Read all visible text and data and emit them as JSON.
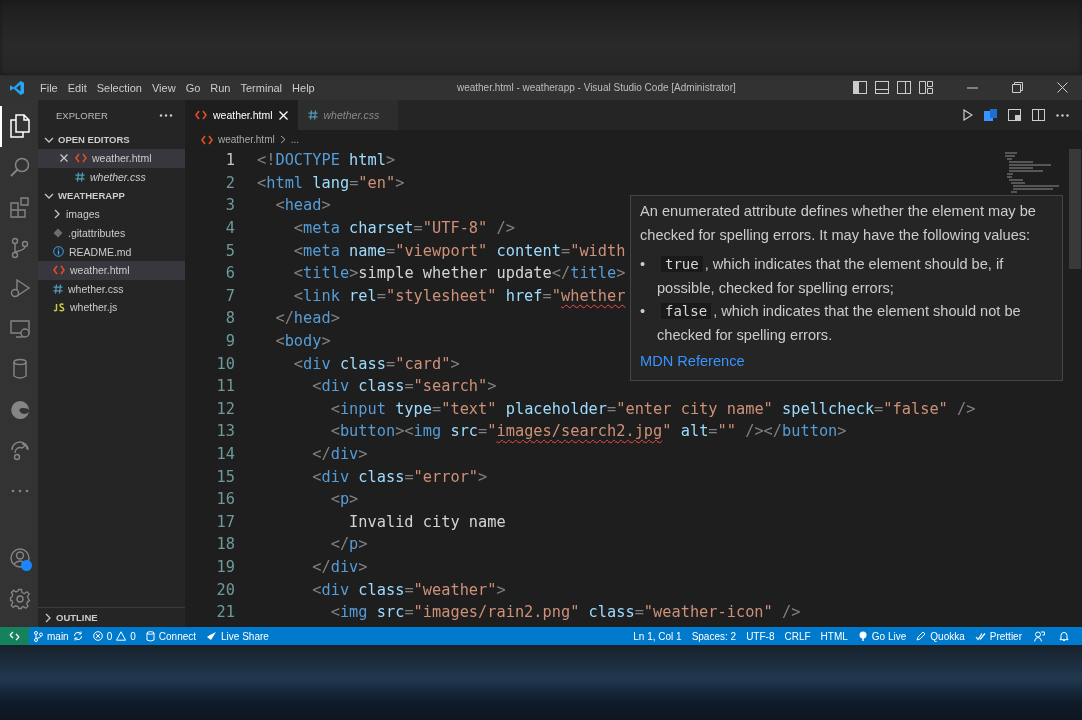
{
  "title_bar": {
    "menus": [
      "File",
      "Edit",
      "Selection",
      "View",
      "Go",
      "Run",
      "Terminal",
      "Help"
    ],
    "title": "weather.html - weatherapp - Visual Studio Code [Administrator]"
  },
  "activity_bar": {
    "items": [
      {
        "kind": "files",
        "selected": true
      },
      {
        "kind": "search",
        "selected": false
      },
      {
        "kind": "extensions",
        "selected": false
      },
      {
        "kind": "source-control",
        "selected": false
      },
      {
        "kind": "run-debug",
        "selected": false
      },
      {
        "kind": "remote",
        "selected": false
      },
      {
        "kind": "database",
        "selected": false
      },
      {
        "kind": "edge",
        "selected": false
      },
      {
        "kind": "live-share",
        "selected": false
      },
      {
        "kind": "more",
        "selected": false
      }
    ],
    "bottom": [
      {
        "kind": "account",
        "badge": true
      },
      {
        "kind": "settings",
        "badge": false
      }
    ]
  },
  "sidebar": {
    "title": "EXPLORER",
    "open_editors": {
      "label": "OPEN EDITORS",
      "expanded": true,
      "items": [
        {
          "name": "weather.html",
          "kind": "html",
          "selected": true,
          "preview": false
        },
        {
          "name": "whether.css",
          "kind": "css",
          "selected": false,
          "preview": true
        }
      ]
    },
    "folder": {
      "label": "WEATHERAPP",
      "expanded": true,
      "children": [
        {
          "name": "images",
          "kind": "folder",
          "selected": false
        },
        {
          "name": ".gitattributes",
          "kind": "git",
          "selected": false
        },
        {
          "name": "README.md",
          "kind": "md",
          "selected": false
        },
        {
          "name": "weather.html",
          "kind": "html",
          "selected": true
        },
        {
          "name": "whether.css",
          "kind": "css",
          "selected": false
        },
        {
          "name": "whether.js",
          "kind": "js",
          "selected": false
        }
      ]
    },
    "outline": {
      "label": "OUTLINE",
      "expanded": false
    }
  },
  "tabs": [
    {
      "name": "weather.html",
      "kind": "html",
      "selected": true,
      "preview": false
    },
    {
      "name": "whether.css",
      "kind": "css",
      "selected": false,
      "preview": true
    }
  ],
  "breadcrumb": {
    "file": "weather.html",
    "kind": "html",
    "rest": "..."
  },
  "editor": {
    "lines": [
      {
        "number": "1",
        "current": true,
        "tokens": [
          {
            "kind": "p",
            "text": "<!"
          },
          {
            "kind": "tag",
            "text": "DOCTYPE"
          },
          {
            "kind": "attr",
            "text": " html"
          },
          {
            "kind": "p",
            "text": ">"
          }
        ]
      },
      {
        "number": "2",
        "current": false,
        "tokens": [
          {
            "kind": "p",
            "text": "<"
          },
          {
            "kind": "tag",
            "text": "html"
          },
          {
            "kind": "attr",
            "text": " lang"
          },
          {
            "kind": "p",
            "text": "="
          },
          {
            "kind": "str",
            "text": "\"en\""
          },
          {
            "kind": "p",
            "text": ">"
          }
        ]
      },
      {
        "number": "3",
        "current": false,
        "tokens": [
          {
            "kind": "p",
            "text": "  <"
          },
          {
            "kind": "tag",
            "text": "head"
          },
          {
            "kind": "p",
            "text": ">"
          }
        ]
      },
      {
        "number": "4",
        "current": false,
        "tokens": [
          {
            "kind": "p",
            "text": "    <"
          },
          {
            "kind": "tag",
            "text": "meta"
          },
          {
            "kind": "attr",
            "text": " charset"
          },
          {
            "kind": "p",
            "text": "="
          },
          {
            "kind": "str",
            "text": "\"UTF-8\""
          },
          {
            "kind": "p",
            "text": " />"
          }
        ]
      },
      {
        "number": "5",
        "current": false,
        "tokens": [
          {
            "kind": "p",
            "text": "    <"
          },
          {
            "kind": "tag",
            "text": "meta"
          },
          {
            "kind": "attr",
            "text": " name"
          },
          {
            "kind": "p",
            "text": "="
          },
          {
            "kind": "str",
            "text": "\"viewport\""
          },
          {
            "kind": "attr",
            "text": " content"
          },
          {
            "kind": "p",
            "text": "="
          },
          {
            "kind": "str",
            "text": "\"width"
          }
        ]
      },
      {
        "number": "6",
        "current": false,
        "tokens": [
          {
            "kind": "p",
            "text": "    <"
          },
          {
            "kind": "tag",
            "text": "title"
          },
          {
            "kind": "p",
            "text": ">"
          },
          {
            "kind": "text",
            "text": "simple whether update"
          },
          {
            "kind": "p",
            "text": "</"
          },
          {
            "kind": "tag",
            "text": "title"
          },
          {
            "kind": "p",
            "text": ">"
          }
        ]
      },
      {
        "number": "7",
        "current": false,
        "tokens": [
          {
            "kind": "p",
            "text": "    <"
          },
          {
            "kind": "tag",
            "text": "link"
          },
          {
            "kind": "attr",
            "text": " rel"
          },
          {
            "kind": "p",
            "text": "="
          },
          {
            "kind": "str",
            "text": "\"stylesheet\""
          },
          {
            "kind": "attr",
            "text": " href"
          },
          {
            "kind": "p",
            "text": "="
          },
          {
            "kind": "str",
            "text": "\""
          },
          {
            "kind": "str",
            "text": "whether",
            "squiggle": true
          }
        ]
      },
      {
        "number": "8",
        "current": false,
        "tokens": [
          {
            "kind": "p",
            "text": "  </"
          },
          {
            "kind": "tag",
            "text": "head"
          },
          {
            "kind": "p",
            "text": ">"
          }
        ]
      },
      {
        "number": "9",
        "current": false,
        "tokens": [
          {
            "kind": "p",
            "text": "  <"
          },
          {
            "kind": "tag",
            "text": "body"
          },
          {
            "kind": "p",
            "text": ">"
          }
        ]
      },
      {
        "number": "10",
        "current": false,
        "tokens": [
          {
            "kind": "p",
            "text": "    <"
          },
          {
            "kind": "tag",
            "text": "div"
          },
          {
            "kind": "attr",
            "text": " class"
          },
          {
            "kind": "p",
            "text": "="
          },
          {
            "kind": "str",
            "text": "\"card\""
          },
          {
            "kind": "p",
            "text": ">"
          }
        ]
      },
      {
        "number": "11",
        "current": false,
        "tokens": [
          {
            "kind": "p",
            "text": "      <"
          },
          {
            "kind": "tag",
            "text": "div"
          },
          {
            "kind": "attr",
            "text": " class"
          },
          {
            "kind": "p",
            "text": "="
          },
          {
            "kind": "str",
            "text": "\"search\""
          },
          {
            "kind": "p",
            "text": ">"
          }
        ]
      },
      {
        "number": "12",
        "current": false,
        "tokens": [
          {
            "kind": "p",
            "text": "        <"
          },
          {
            "kind": "tag",
            "text": "input"
          },
          {
            "kind": "attr",
            "text": " type"
          },
          {
            "kind": "p",
            "text": "="
          },
          {
            "kind": "str",
            "text": "\"text\""
          },
          {
            "kind": "attr",
            "text": " placeholder"
          },
          {
            "kind": "p",
            "text": "="
          },
          {
            "kind": "str",
            "text": "\"enter city name\""
          },
          {
            "kind": "attr",
            "text": " spellcheck"
          },
          {
            "kind": "p",
            "text": "="
          },
          {
            "kind": "str",
            "text": "\"false\""
          },
          {
            "kind": "p",
            "text": " />"
          }
        ]
      },
      {
        "number": "13",
        "current": false,
        "tokens": [
          {
            "kind": "p",
            "text": "        <"
          },
          {
            "kind": "tag",
            "text": "button"
          },
          {
            "kind": "p",
            "text": "><"
          },
          {
            "kind": "tag",
            "text": "img"
          },
          {
            "kind": "attr",
            "text": " src"
          },
          {
            "kind": "p",
            "text": "="
          },
          {
            "kind": "str",
            "text": "\""
          },
          {
            "kind": "str",
            "text": "images/search2.jpg",
            "squiggle": true
          },
          {
            "kind": "str",
            "text": "\""
          },
          {
            "kind": "attr",
            "text": " alt"
          },
          {
            "kind": "p",
            "text": "="
          },
          {
            "kind": "str",
            "text": "\"\""
          },
          {
            "kind": "p",
            "text": " /></"
          },
          {
            "kind": "tag",
            "text": "button"
          },
          {
            "kind": "p",
            "text": ">"
          }
        ]
      },
      {
        "number": "14",
        "current": false,
        "tokens": [
          {
            "kind": "p",
            "text": "      </"
          },
          {
            "kind": "tag",
            "text": "div"
          },
          {
            "kind": "p",
            "text": ">"
          }
        ]
      },
      {
        "number": "15",
        "current": false,
        "tokens": [
          {
            "kind": "p",
            "text": "      <"
          },
          {
            "kind": "tag",
            "text": "div"
          },
          {
            "kind": "attr",
            "text": " class"
          },
          {
            "kind": "p",
            "text": "="
          },
          {
            "kind": "str",
            "text": "\"error\""
          },
          {
            "kind": "p",
            "text": ">"
          }
        ]
      },
      {
        "number": "16",
        "current": false,
        "tokens": [
          {
            "kind": "p",
            "text": "        <"
          },
          {
            "kind": "tag",
            "text": "p"
          },
          {
            "kind": "p",
            "text": ">"
          }
        ]
      },
      {
        "number": "17",
        "current": false,
        "tokens": [
          {
            "kind": "text",
            "text": "          Invalid city name"
          }
        ]
      },
      {
        "number": "18",
        "current": false,
        "tokens": [
          {
            "kind": "p",
            "text": "        </"
          },
          {
            "kind": "tag",
            "text": "p"
          },
          {
            "kind": "p",
            "text": ">"
          }
        ]
      },
      {
        "number": "19",
        "current": false,
        "tokens": [
          {
            "kind": "p",
            "text": "      </"
          },
          {
            "kind": "tag",
            "text": "div"
          },
          {
            "kind": "p",
            "text": ">"
          }
        ]
      },
      {
        "number": "20",
        "current": false,
        "tokens": [
          {
            "kind": "p",
            "text": "      <"
          },
          {
            "kind": "tag",
            "text": "div"
          },
          {
            "kind": "attr",
            "text": " class"
          },
          {
            "kind": "p",
            "text": "="
          },
          {
            "kind": "str",
            "text": "\"weather\""
          },
          {
            "kind": "p",
            "text": ">"
          }
        ]
      },
      {
        "number": "21",
        "current": false,
        "tokens": [
          {
            "kind": "p",
            "text": "        <"
          },
          {
            "kind": "tag",
            "text": "img"
          },
          {
            "kind": "attr",
            "text": " src"
          },
          {
            "kind": "p",
            "text": "="
          },
          {
            "kind": "str",
            "text": "\"images/rain2.png\""
          },
          {
            "kind": "attr",
            "text": " class"
          },
          {
            "kind": "p",
            "text": "="
          },
          {
            "kind": "str",
            "text": "\"weather-icon\""
          },
          {
            "kind": "p",
            "text": " />"
          }
        ]
      }
    ]
  },
  "hover": {
    "paragraph": "An enumerated attribute defines whether the element may be checked for spelling errors. It may have the following values:",
    "bullets": [
      {
        "marker": "•",
        "code": "true",
        "text": ", which indicates that the element should be, if possible, checked for spelling errors;"
      },
      {
        "marker": "•",
        "code": "false",
        "text": ", which indicates that the element should not be checked for spelling errors."
      }
    ],
    "link": "MDN Reference"
  },
  "status_bar": {
    "left": [
      {
        "kind": "remote"
      },
      {
        "kind": "branch",
        "text": "main"
      },
      {
        "kind": "problems",
        "errors": "0",
        "warnings": "0"
      },
      {
        "kind": "connect",
        "text": "Connect"
      },
      {
        "kind": "liveshare",
        "text": "Live Share"
      }
    ],
    "right": [
      {
        "kind": "text",
        "text": "Ln 1, Col 1"
      },
      {
        "kind": "text",
        "text": "Spaces: 2"
      },
      {
        "kind": "text",
        "text": "UTF-8"
      },
      {
        "kind": "text",
        "text": "CRLF"
      },
      {
        "kind": "text",
        "text": "HTML"
      },
      {
        "kind": "golive",
        "text": "Go Live"
      },
      {
        "kind": "quokka",
        "text": "Quokka"
      },
      {
        "kind": "prettier",
        "text": "Prettier"
      },
      {
        "kind": "feedback"
      },
      {
        "kind": "bell"
      }
    ]
  }
}
